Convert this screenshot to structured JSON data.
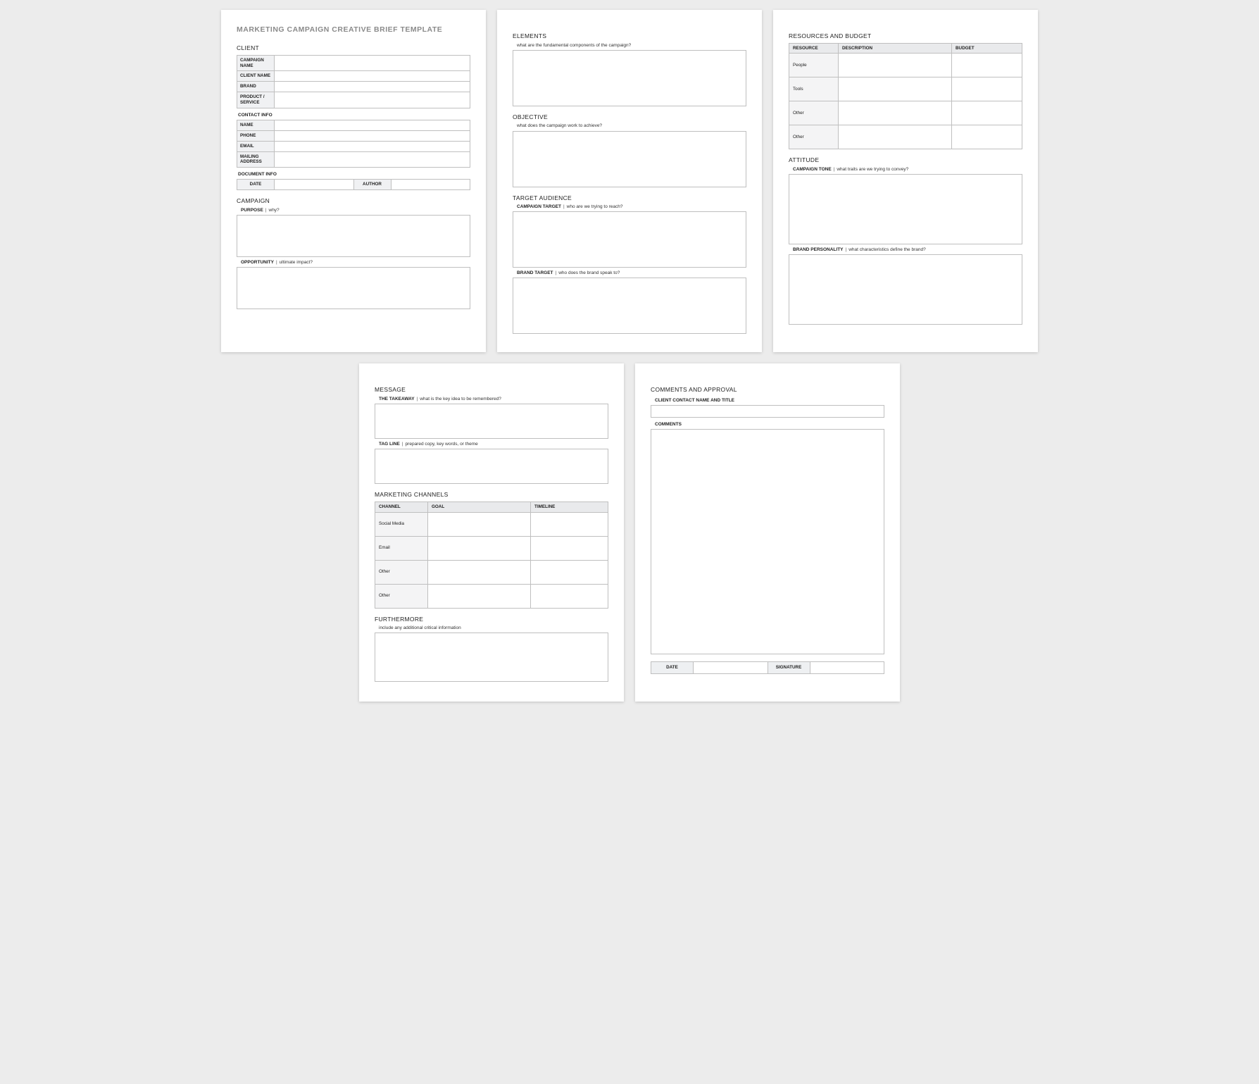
{
  "doc": {
    "title": "MARKETING CAMPAIGN CREATIVE BRIEF TEMPLATE"
  },
  "client": {
    "heading": "CLIENT",
    "rows": {
      "campaign_name": "CAMPAIGN NAME",
      "client_name": "CLIENT NAME",
      "brand": "BRAND",
      "product_service": "PRODUCT / SERVICE"
    },
    "contact_heading": "CONTACT INFO",
    "contact_rows": {
      "name": "NAME",
      "phone": "PHONE",
      "email": "EMAIL",
      "mailing": "MAILING ADDRESS"
    },
    "docinfo_heading": "DOCUMENT INFO",
    "docinfo": {
      "date": "DATE",
      "author": "AUTHOR"
    }
  },
  "campaign": {
    "heading": "CAMPAIGN",
    "purpose_label": "PURPOSE",
    "purpose_hint": "why?",
    "opportunity_label": "OPPORTUNITY",
    "opportunity_hint": "ultimate impact?"
  },
  "elements": {
    "heading": "ELEMENTS",
    "hint": "what are the fundamental components of the campaign?"
  },
  "objective": {
    "heading": "OBJECTIVE",
    "hint": "what does the campaign work to achieve?"
  },
  "audience": {
    "heading": "TARGET AUDIENCE",
    "campaign_target_label": "CAMPAIGN TARGET",
    "campaign_target_hint": "who are we trying to reach?",
    "brand_target_label": "BRAND TARGET",
    "brand_target_hint": "who does the brand speak to?"
  },
  "resources": {
    "heading": "RESOURCES AND BUDGET",
    "columns": {
      "resource": "RESOURCE",
      "description": "DESCRIPTION",
      "budget": "BUDGET"
    },
    "rows": [
      "People",
      "Tools",
      "Other",
      "Other"
    ]
  },
  "attitude": {
    "heading": "ATTITUDE",
    "tone_label": "CAMPAIGN TONE",
    "tone_hint": "what traits are we trying to convey?",
    "personality_label": "BRAND PERSONALITY",
    "personality_hint": "what characteristics define the brand?"
  },
  "message": {
    "heading": "MESSAGE",
    "takeaway_label": "THE TAKEAWAY",
    "takeaway_hint": "what is the key idea to be remembered?",
    "tagline_label": "TAG LINE",
    "tagline_hint": "prepared copy, key words, or theme"
  },
  "channels": {
    "heading": "MARKETING CHANNELS",
    "columns": {
      "channel": "CHANNEL",
      "goal": "GOAL",
      "timeline": "TIMELINE"
    },
    "rows": [
      "Social Media",
      "Email",
      "Other",
      "Other"
    ]
  },
  "furthermore": {
    "heading": "FURTHERMORE",
    "hint": "include any additional critical information"
  },
  "approval": {
    "heading": "COMMENTS AND APPROVAL",
    "contact_label": "CLIENT CONTACT NAME AND TITLE",
    "comments_label": "COMMENTS",
    "date": "DATE",
    "signature": "SIGNATURE"
  }
}
